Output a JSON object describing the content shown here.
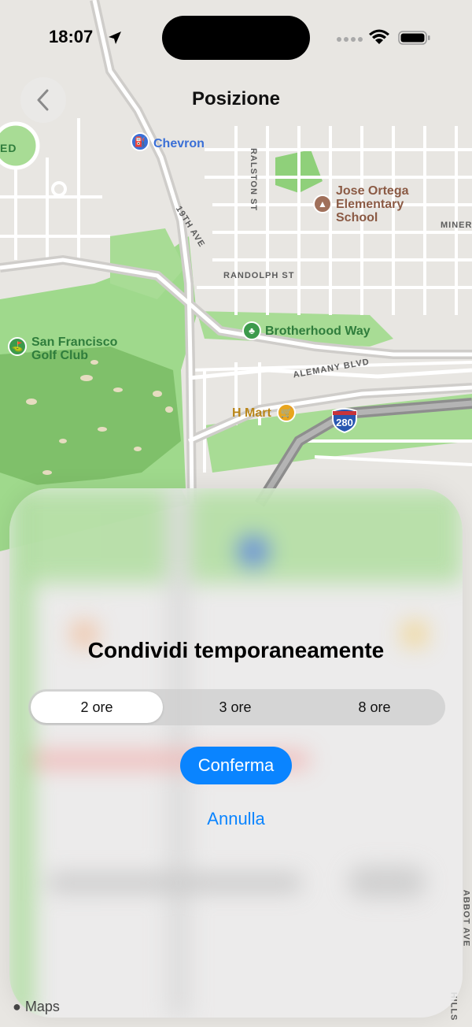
{
  "status_bar": {
    "time": "18:07"
  },
  "nav": {
    "title": "Posizione"
  },
  "map": {
    "labels": {
      "chevron": "Chevron",
      "school_line1": "Jose Ortega",
      "school_line2": "Elementary",
      "school_line3": "School",
      "golf_line1": "San Francisco",
      "golf_line2": "Golf Club",
      "brotherhood": "Brotherhood Way",
      "hmart": "H Mart",
      "randolph": "RANDOLPH ST",
      "alemany": "ALEMANY BLVD",
      "ave19": "19TH AVE",
      "ralston": "RALSTON ST",
      "miner": "MINER",
      "ed": "ED",
      "abbot": "ABBOT AVE",
      "hills": "HILLS",
      "highway": "280",
      "maps": "Maps"
    }
  },
  "sheet": {
    "title": "Condividi temporaneamente",
    "options": [
      {
        "label": "2 ore",
        "selected": true
      },
      {
        "label": "3 ore",
        "selected": false
      },
      {
        "label": "8 ore",
        "selected": false
      }
    ],
    "confirm_label": "Conferma",
    "cancel_label": "Annulla"
  },
  "colors": {
    "accent": "#0a84ff",
    "park": "#8fd07a",
    "road": "#ffffff"
  }
}
